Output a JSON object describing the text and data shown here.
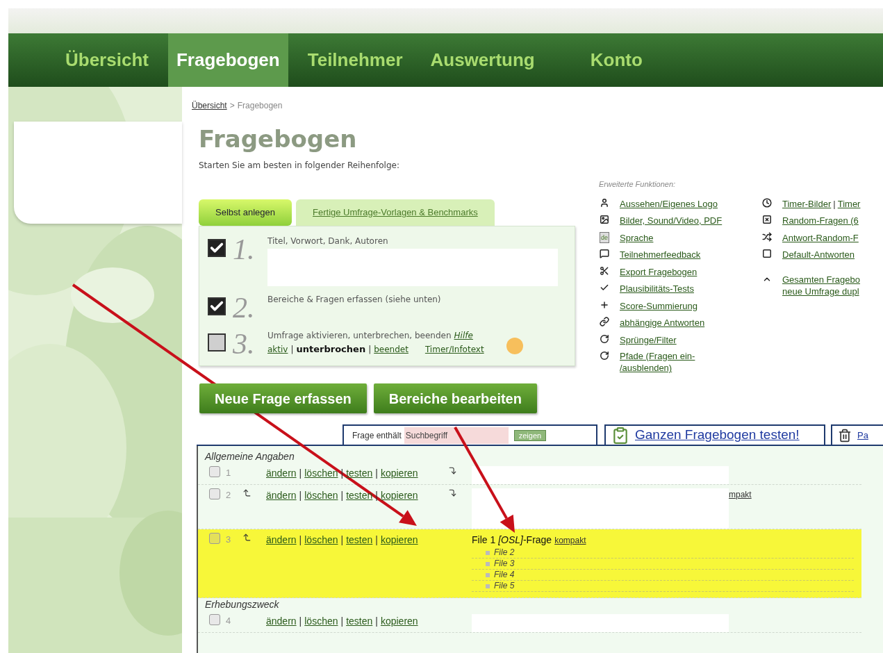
{
  "nav": {
    "items": [
      {
        "label": "Übersicht",
        "selected": false
      },
      {
        "label": "Fragebogen",
        "selected": true
      },
      {
        "label": "Teilnehmer",
        "selected": false
      },
      {
        "label": "Auswertung",
        "selected": false
      },
      {
        "label": "Konto",
        "selected": false
      }
    ]
  },
  "breadcrumb": {
    "link": "Übersicht",
    "separator": ">",
    "current": "Fragebogen"
  },
  "page": {
    "title": "Fragebogen",
    "subtitle": "Starten Sie am besten in folgender Reihenfolge:"
  },
  "step_tabs": [
    {
      "label": "Selbst anlegen",
      "selected": true
    },
    {
      "label": "Fertige Umfrage-Vorlagen & Benchmarks",
      "selected": false
    }
  ],
  "steps": [
    {
      "number": "1.",
      "checked": true,
      "text": "Titel, Vorwort, Dank, Autoren",
      "redacted": true
    },
    {
      "number": "2.",
      "checked": true,
      "text": "Bereiche & Fragen erfassen (siehe unten)"
    },
    {
      "number": "3.",
      "checked": false,
      "text": "Umfrage aktivieren, unterbrechen, beenden",
      "help_link": "Hilfe",
      "status_options": [
        {
          "label": "aktiv",
          "selected": false
        },
        {
          "label": "unterbrochen",
          "selected": true
        },
        {
          "label": "beendet",
          "selected": false
        }
      ],
      "separator": "|",
      "extra_link": "Timer/Infotext",
      "color": "#f7bf5c"
    }
  ],
  "features": {
    "heading": "Erweiterte Funktionen:",
    "columns": [
      [
        {
          "links": [
            "Aussehen/Eigenes Logo"
          ]
        },
        {
          "links": [
            "Bilder, Sound/Video, PDF"
          ]
        },
        {
          "badge": "de",
          "links": [
            "Sprache"
          ]
        },
        {
          "links": [
            "Teilnehmerfeedback"
          ]
        },
        {
          "links": [
            "Export Fragebogen"
          ]
        },
        {
          "links": [
            "Plausibilitäts-Tests"
          ]
        },
        {
          "links": [
            "Score-Summierung"
          ]
        },
        {
          "links": [
            "abhängige Antworten"
          ]
        },
        {
          "links": [
            "Sprünge/Filter"
          ]
        },
        {
          "lines": [
            "Pfade (Fragen ein-",
            "/ausblenden)"
          ]
        }
      ],
      [
        {
          "links": [
            "Timer-Bilder",
            "Timer"
          ],
          "separator": "|"
        },
        {
          "links": [
            "Random-Fragen (6"
          ]
        },
        {
          "links": [
            "Antwort-Random-F"
          ]
        },
        {
          "links": [
            "Default-Antworten"
          ]
        },
        {
          "lines": [
            "Gesamten Fragebo",
            "neue Umfrage dupl"
          ]
        }
      ]
    ]
  },
  "buttons": [
    "Neue Frage erfassen",
    "Bereiche bearbeiten"
  ],
  "filter": {
    "label": "Frage enthält",
    "placeholder": "Suchbegriff",
    "button": "zeigen"
  },
  "list_tabs": [
    {
      "label": "Ganzen Fragebogen testen!"
    },
    {
      "label": "Pa"
    }
  ],
  "sections": [
    {
      "title": "Allgemeine Angaben",
      "questions": [
        {
          "number": "1",
          "checked": false,
          "highlighted": false,
          "move_up": false,
          "move_down": true,
          "separator": "|",
          "actions": [
            "ändern",
            "löschen",
            "testen",
            "kopieren"
          ],
          "content": {
            "redacted": true
          }
        },
        {
          "number": "2",
          "checked": false,
          "highlighted": false,
          "move_up": true,
          "move_down": true,
          "separator": "|",
          "actions": [
            "ändern",
            "löschen",
            "testen",
            "kopieren"
          ],
          "content": {
            "redacted": true,
            "link": "mpakt"
          }
        },
        {
          "number": "3",
          "checked": false,
          "highlighted": true,
          "move_up": true,
          "move_down": false,
          "separator": "|",
          "actions": [
            "ändern",
            "löschen",
            "testen",
            "kopieren"
          ],
          "content": {
            "title": "File 1 *[OSL]*-Frage",
            "link": "kompakt",
            "items": [
              "File 2",
              "File 3",
              "File 4",
              "File 5"
            ]
          }
        }
      ]
    },
    {
      "title": "Erhebungszweck",
      "questions": [
        {
          "number": "4",
          "checked": false,
          "highlighted": false,
          "move_up": false,
          "move_down": false,
          "separator": "|",
          "actions": [
            "ändern",
            "löschen",
            "testen",
            "kopieren"
          ],
          "content": {
            "redacted": true
          }
        }
      ]
    }
  ]
}
